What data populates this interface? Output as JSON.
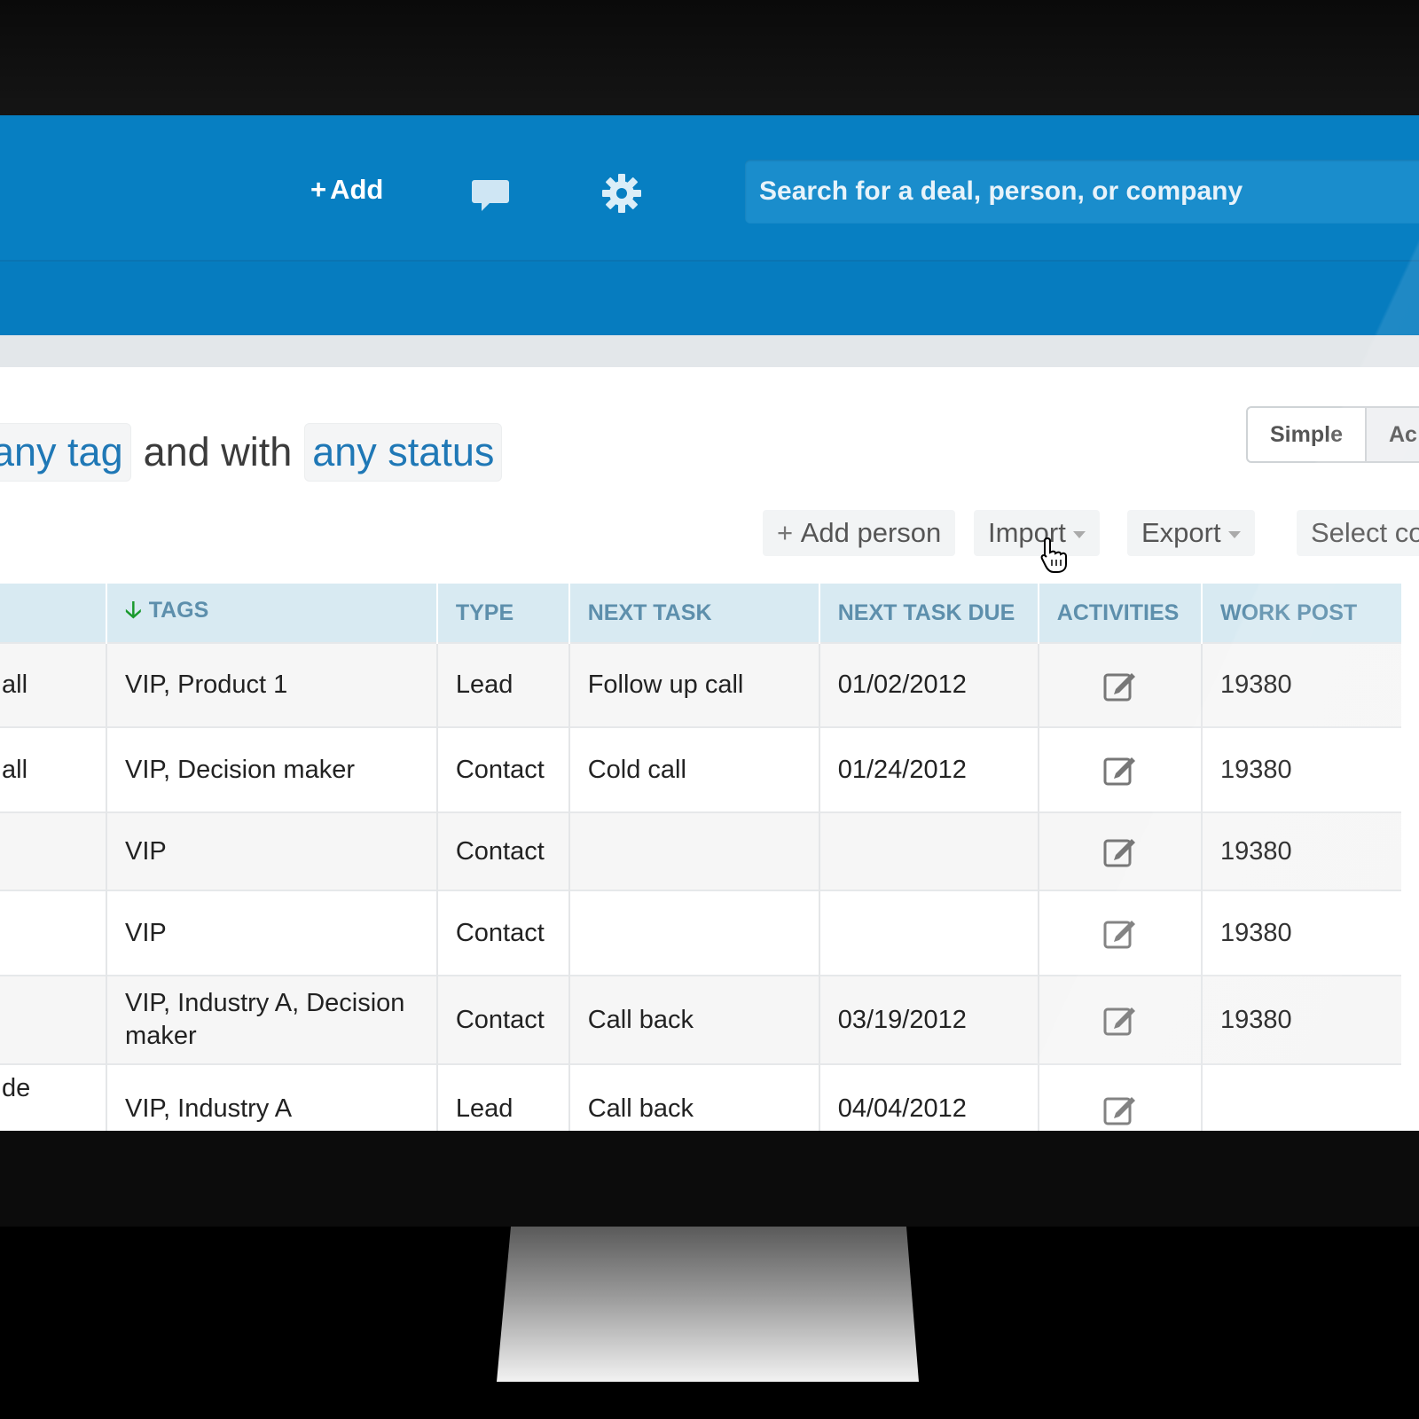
{
  "header": {
    "add_label": "Add",
    "search_placeholder": "Search for a deal, person, or company"
  },
  "filter": {
    "tag_chip": "any tag",
    "connector": "and with",
    "status_chip": "any status"
  },
  "view_toggle": {
    "simple": "Simple",
    "advanced": "Ac"
  },
  "toolbar": {
    "add_person": "Add person",
    "import": "Import",
    "export": "Export",
    "select": "Select co"
  },
  "table": {
    "columns": [
      "TAGS",
      "TYPE",
      "NEXT TASK",
      "NEXT TASK DUE",
      "ACTIVITIES",
      "WORK POST"
    ],
    "rows": [
      {
        "prev": "all",
        "tags": "VIP, Product 1",
        "type": "Lead",
        "next_task": "Follow up call",
        "due": "01/02/2012",
        "work": "19380"
      },
      {
        "prev": "all",
        "tags": "VIP, Decision maker",
        "type": "Contact",
        "next_task": "Cold call",
        "due": "01/24/2012",
        "work": "19380"
      },
      {
        "prev": "",
        "tags": "VIP",
        "type": "Contact",
        "next_task": "",
        "due": "",
        "work": "19380"
      },
      {
        "prev": "",
        "tags": "VIP",
        "type": "Contact",
        "next_task": "",
        "due": "",
        "work": "19380"
      },
      {
        "prev": "",
        "tags": "VIP, Industry A, Decision maker",
        "type": "Contact",
        "next_task": "Call back",
        "due": "03/19/2012",
        "work": "19380"
      },
      {
        "prev": "de",
        "tags": "VIP, Industry A",
        "type": "Lead",
        "next_task": "Call back",
        "due": "04/04/2012",
        "work": ""
      }
    ]
  },
  "colors": {
    "topbar": "#077fc2",
    "link_blue": "#1f78b6",
    "header_row": "#d8eaf2",
    "sort_arrow": "#1a9a2e"
  },
  "icons": {
    "chat": "chat-bubble-icon",
    "settings": "gear-icon",
    "sort": "arrow-down-icon",
    "activity": "edit-icon",
    "cursor": "hand-pointer-icon"
  }
}
